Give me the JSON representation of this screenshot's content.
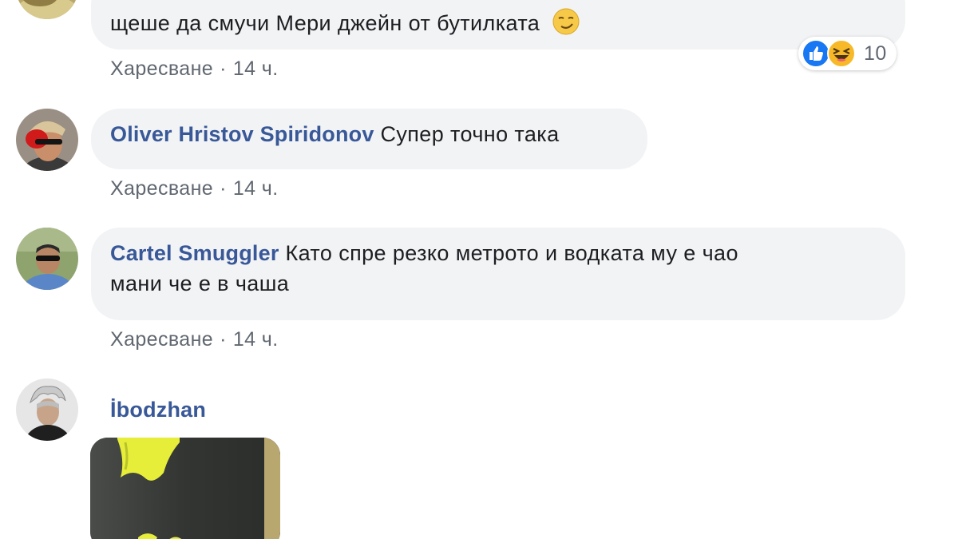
{
  "comments": [
    {
      "author": "",
      "text": "щеше да смучи Мери джейн от бутилката",
      "actions": {
        "like_label": "Харесване",
        "separator": "·",
        "time": "14 ч."
      },
      "reactions": {
        "icons": [
          "like-icon",
          "haha-icon"
        ],
        "count": "10",
        "colors": {
          "like": "#1877f2",
          "haha": "#f7b928"
        }
      }
    },
    {
      "author": "Oliver Hristov Spiridonov",
      "text": "Супер точно така",
      "actions": {
        "like_label": "Харесване",
        "separator": "·",
        "time": "14 ч."
      }
    },
    {
      "author": "Cartel Smuggler",
      "text_line1": "Като спре резко метрото и водката му е чао",
      "text_line2": "мани че е в чаша",
      "actions": {
        "like_label": "Харесване",
        "separator": "·",
        "time": "14 ч."
      }
    },
    {
      "author": "İbodzhan",
      "attachment": "sticker-image"
    }
  ],
  "colors": {
    "bubble_bg": "#f2f3f5",
    "author_link": "#385898",
    "meta_text": "#606770",
    "body_text": "#1c1e21"
  }
}
